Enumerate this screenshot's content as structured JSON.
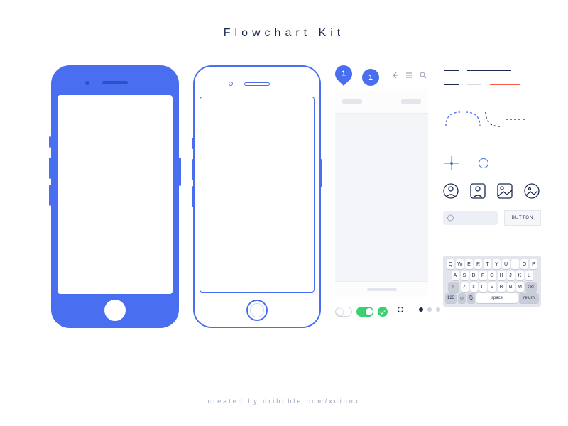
{
  "title": "Flowchart Kit",
  "credit": "created by dribbble.com/xdionx",
  "pin_1": "1",
  "pin_circle": "1",
  "button_label": "BUTTON",
  "keyboard": {
    "r1": [
      "Q",
      "W",
      "E",
      "R",
      "T",
      "Y",
      "U",
      "I",
      "O",
      "P"
    ],
    "r2": [
      "A",
      "S",
      "D",
      "F",
      "G",
      "H",
      "J",
      "K",
      "L"
    ],
    "r3": [
      "Z",
      "X",
      "C",
      "V",
      "B",
      "N",
      "M"
    ],
    "r4": {
      "globe": "⊕",
      "mic": "🎤",
      "space": "space",
      "ret": "return",
      "num": "123"
    }
  }
}
